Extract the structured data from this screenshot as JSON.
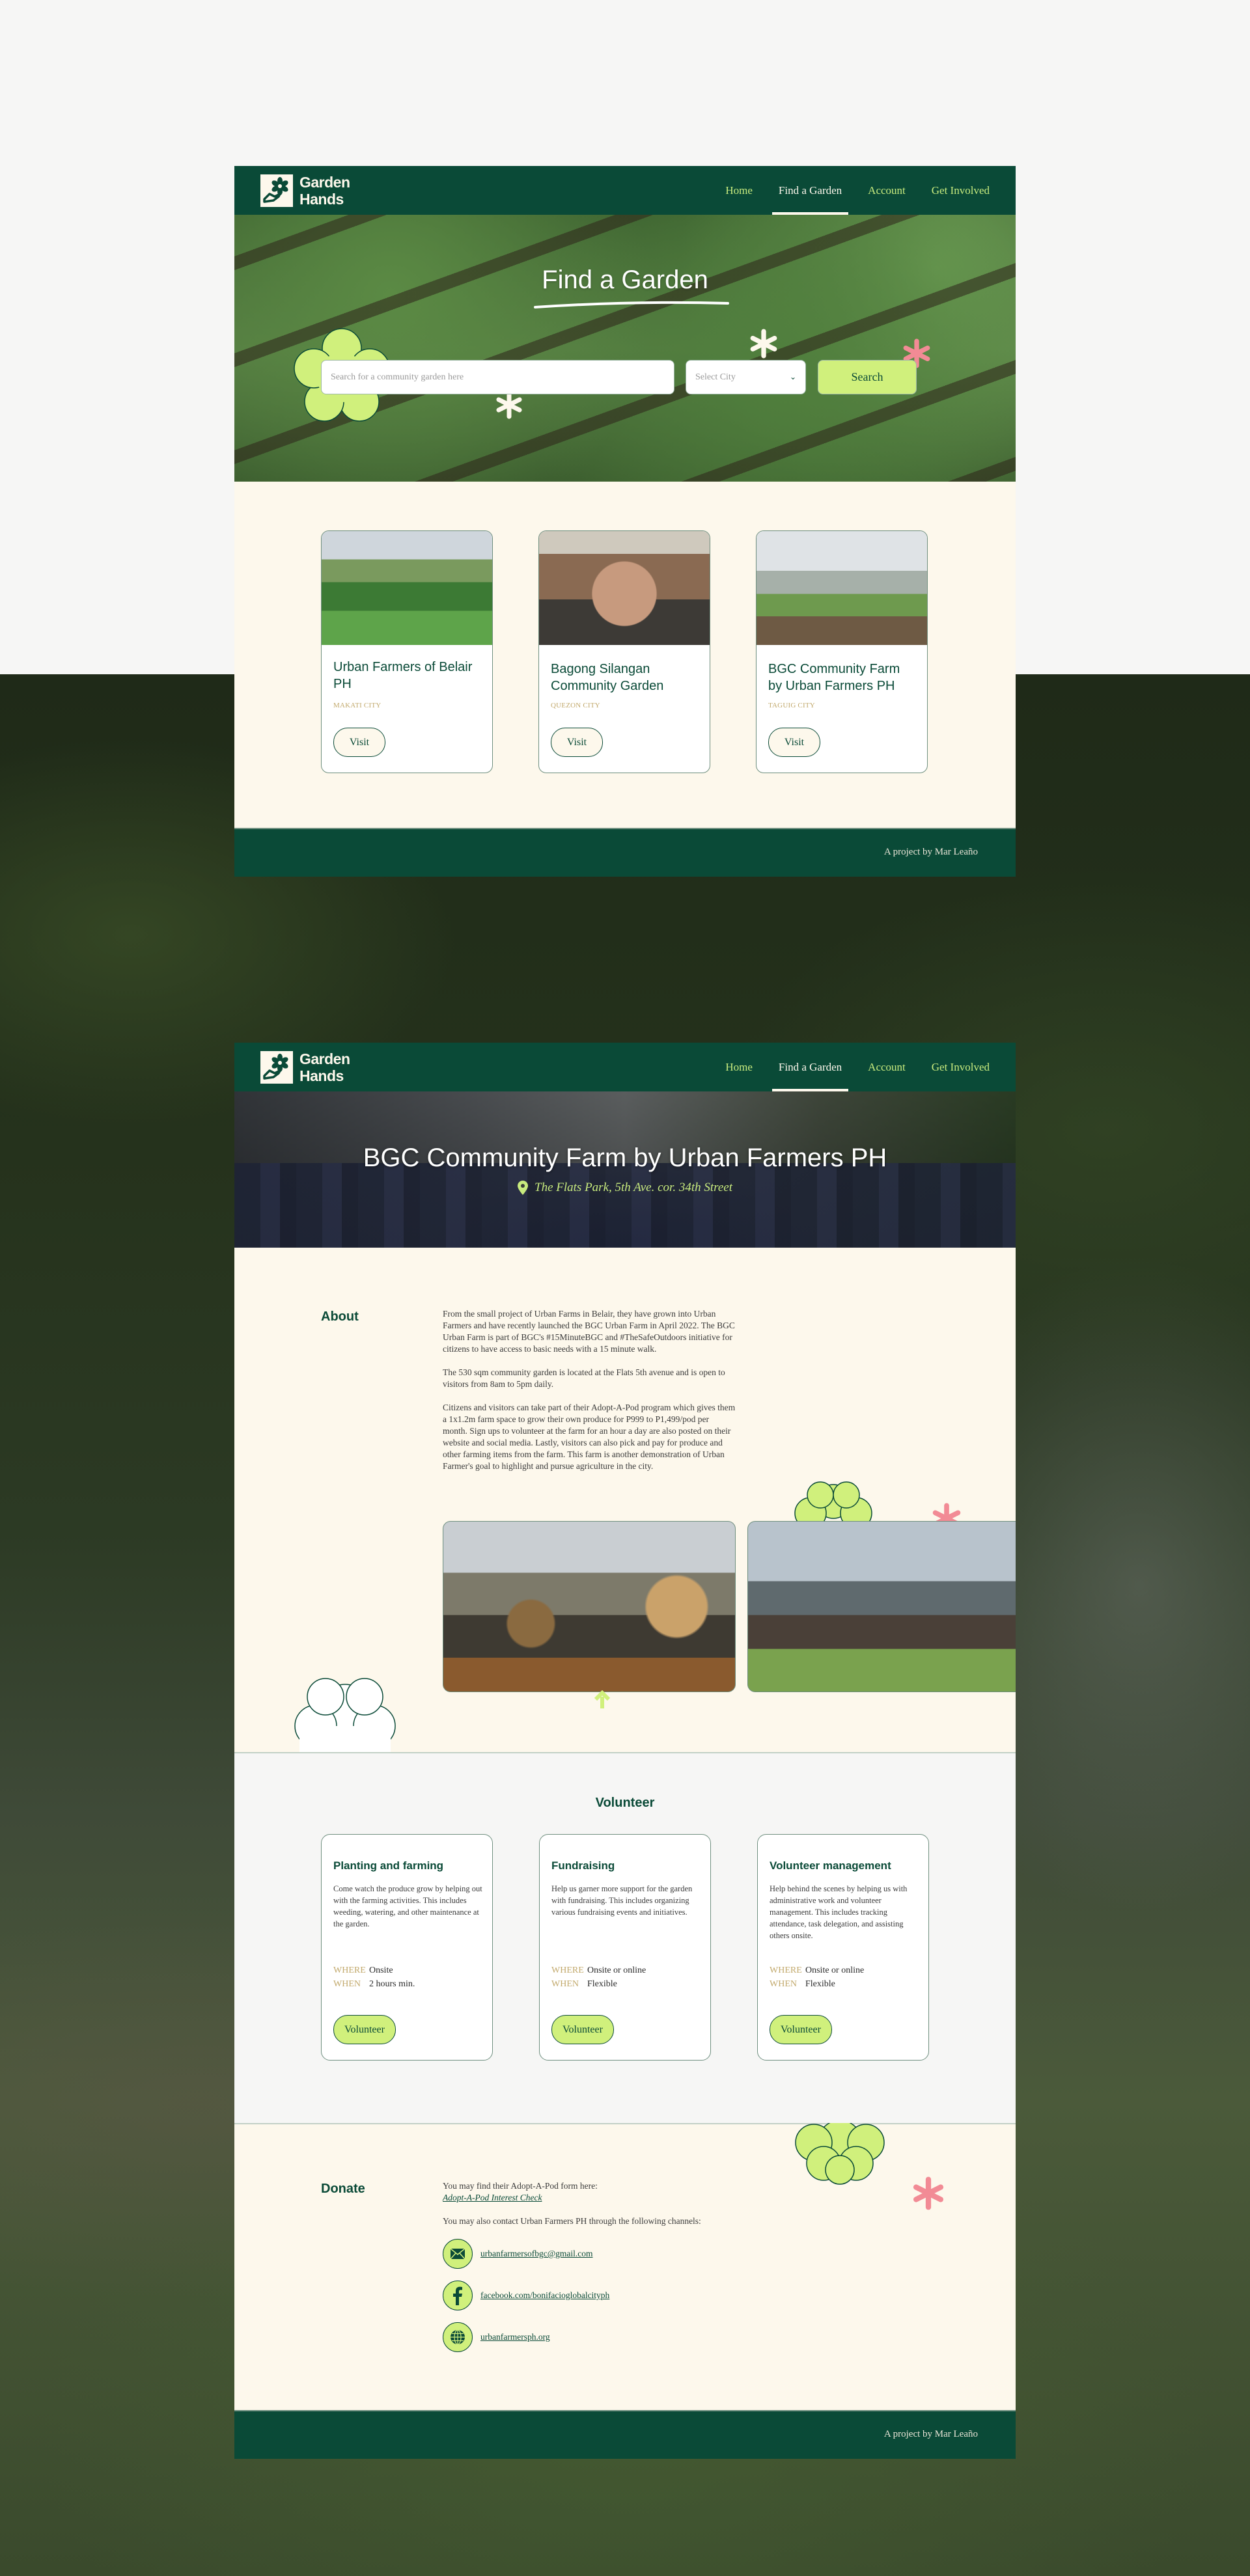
{
  "brand": {
    "name_line1": "Garden",
    "name_line2": "Hands"
  },
  "nav": {
    "items": [
      {
        "label": "Home",
        "active": false
      },
      {
        "label": "Find a Garden",
        "active": true
      },
      {
        "label": "Account",
        "active": false
      },
      {
        "label": "Get Involved",
        "active": false
      }
    ]
  },
  "find_page": {
    "hero_title": "Find a Garden",
    "search": {
      "placeholder": "Search for a community garden here",
      "value": ""
    },
    "city_select": {
      "selected": "Select City"
    },
    "search_button": "Search",
    "gardens": [
      {
        "name": "Urban Farmers of Belair PH",
        "city": "MAKATI CITY",
        "action": "Visit"
      },
      {
        "name": "Bagong Silangan Community Garden",
        "city": "QUEZON CITY",
        "action": "Visit"
      },
      {
        "name": "BGC Community Farm by Urban Farmers PH",
        "city": "TAGUIG CITY",
        "action": "Visit"
      }
    ]
  },
  "footer": {
    "credit": "A project by Mar Leaño"
  },
  "detail_page": {
    "title": "BGC Community Farm by Urban Farmers PH",
    "location": "The Flats Park, 5th Ave. cor. 34th Street",
    "about": {
      "heading": "About",
      "paragraphs": [
        "From the small project of Urban Farms in Belair, they have grown into Urban Farmers and have recently launched the BGC Urban Farm in April 2022. The BGC Urban Farm is part of BGC's #15MinuteBGC and #TheSafeOutdoors initiative for citizens to have access to basic needs with a 15 minute walk.",
        "The 530 sqm community garden is located at the Flats 5th avenue and is open to visitors from 8am to 5pm daily.",
        "Citizens and visitors can take part of their Adopt-A-Pod program which gives them a 1x1.2m farm space to grow their own produce for P999 to P1,499/pod per month. Sign ups to volunteer at the farm for an hour a day are also posted on their website and social media. Lastly, visitors can also pick and pay for produce and other farming items from the farm. This farm is another demonstration of Urban Farmer's goal to highlight and pursue agriculture in the city."
      ]
    },
    "volunteer": {
      "heading": "Volunteer",
      "where_label": "WHERE",
      "when_label": "WHEN",
      "roles": [
        {
          "title": "Planting and farming",
          "description": "Come watch the produce grow by helping out with the farming activities. This includes weeding, watering, and other maintenance at the garden.",
          "where": "Onsite",
          "when": "2 hours min.",
          "action": "Volunteer"
        },
        {
          "title": "Fundraising",
          "description": "Help us garner more support for the garden with fundraising. This includes organizing various fundraising events and initiatives.",
          "where": "Onsite or online",
          "when": "Flexible",
          "action": "Volunteer"
        },
        {
          "title": "Volunteer management",
          "description": "Help behind the scenes by helping us with administrative work and volunteer management. This includes tracking attendance, task delegation, and assisting others onsite.",
          "where": "Onsite or online",
          "when": "Flexible",
          "action": "Volunteer"
        }
      ]
    },
    "donate": {
      "heading": "Donate",
      "form_intro": "You may find their Adopt-A-Pod form here:",
      "form_link": "Adopt-A-Pod Interest Check",
      "contact_intro": "You may also contact Urban Farmers PH through the following channels:",
      "contacts": [
        {
          "icon": "mail-icon",
          "label": "urbanfarmersofbgc@gmail.com"
        },
        {
          "icon": "facebook-icon",
          "label": "facebook.com/bonifacioglobalcityph"
        },
        {
          "icon": "globe-icon",
          "label": "urbanfarmersph.org"
        }
      ]
    }
  },
  "colors": {
    "primary": "#0a4a37",
    "accent": "#d0f07c",
    "cream": "#fdf8ec",
    "gold": "#c2a96c",
    "pink": "#f28b95"
  }
}
